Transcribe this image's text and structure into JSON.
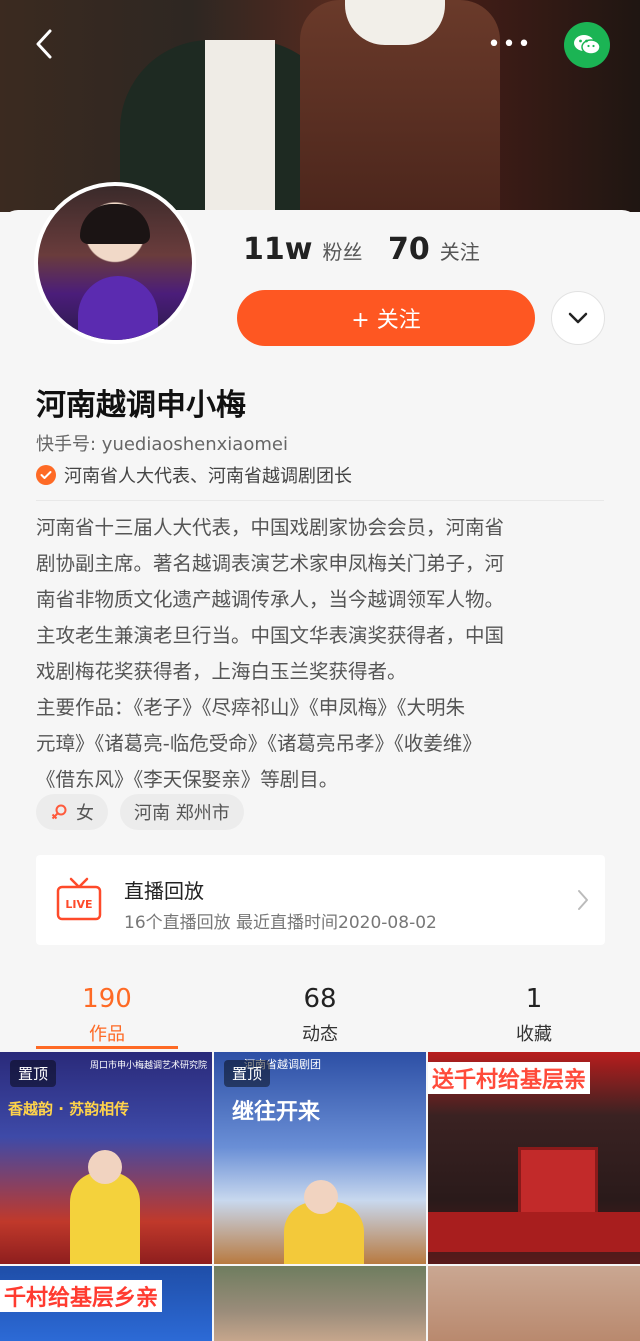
{
  "header": {
    "back_icon": "chevron-left-icon",
    "more_icon": "more-dots-icon",
    "more_label": "•••",
    "share_icon": "wechat-icon"
  },
  "profile": {
    "name": "河南越调申小梅",
    "kuaishou_id": "快手号: yuediaoshenxiaomei",
    "verification": "河南省人大代表、河南省越调剧团长",
    "followers_count": "11w",
    "followers_label": "粉丝",
    "following_count": "70",
    "following_label": "关注",
    "follow_button": "+ 关注",
    "bio_lines": [
      "河南省十三届人大代表，中国戏剧家协会会员，河南省",
      "剧协副主席。著名越调表演艺术家申凤梅关门弟子，河",
      "南省非物质文化遗产越调传承人，当今越调领军人物。",
      "主攻老生兼演老旦行当。中国文华表演奖获得者，中国",
      "戏剧梅花奖获得者，上海白玉兰奖获得者。",
      "主要作品：《老子》《尽瘁祁山》《申凤梅》《大明朱",
      "元璋》《诸葛亮-临危受命》《诸葛亮吊孝》《收姜维》",
      "《借东风》《李天保娶亲》等剧目。"
    ],
    "gender_tag": "女",
    "location_tag": "河南 郑州市"
  },
  "live_replay": {
    "icon_text": "LIVE",
    "title": "直播回放",
    "subtitle": "16个直播回放 最近直播时间2020-08-02"
  },
  "tabs": [
    {
      "count": "190",
      "label": "作品"
    },
    {
      "count": "68",
      "label": "动态"
    },
    {
      "count": "1",
      "label": "收藏"
    }
  ],
  "grid": {
    "pinned_label": "置顶",
    "posters": [
      "香越韵 · 苏韵相传",
      "继往开来",
      "送千村给基层亲",
      "千村给基层乡亲",
      "",
      ""
    ],
    "poster_small": [
      "周口市申小梅越调艺术研究院",
      "河南省越调剧团",
      "",
      "",
      "",
      ""
    ]
  },
  "colors": {
    "accent": "#fe5722",
    "accent_text": "#fe6a25",
    "wechat": "#1bb454"
  }
}
